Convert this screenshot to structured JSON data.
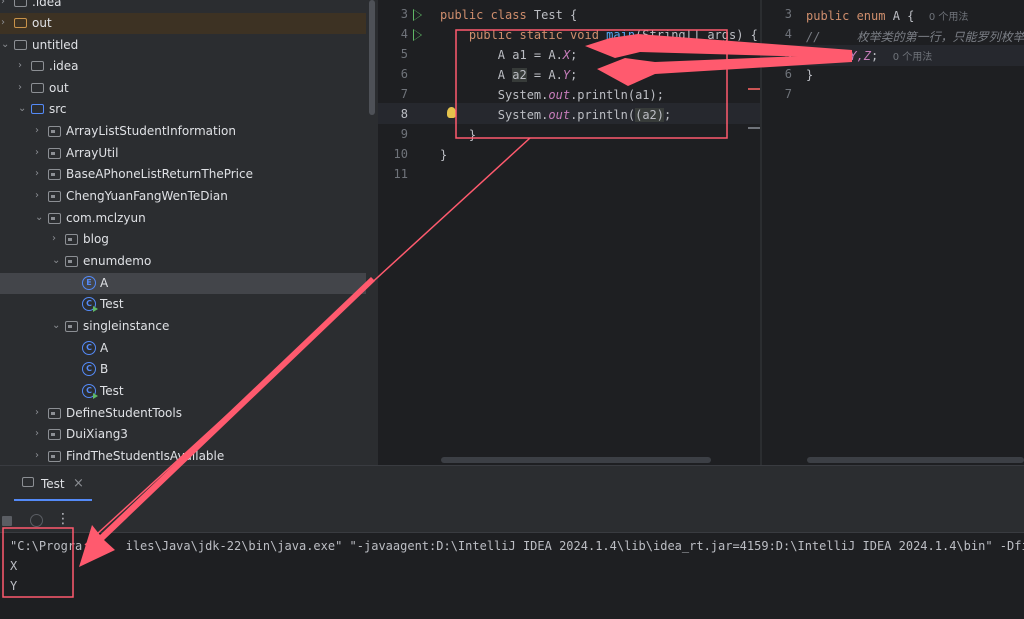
{
  "project_tree": {
    "items": [
      {
        "label": ".idea",
        "kind": "folder"
      },
      {
        "label": "out",
        "kind": "folder-orange"
      },
      {
        "label": "untitled",
        "kind": "folder"
      },
      {
        "label": ".idea",
        "kind": "folder"
      },
      {
        "label": "out",
        "kind": "folder"
      },
      {
        "label": "src",
        "kind": "folder-blue"
      },
      {
        "label": "ArrayListStudentInformation",
        "kind": "package"
      },
      {
        "label": "ArrayUtil",
        "kind": "package"
      },
      {
        "label": "BaseAPhoneListReturnThePrice",
        "kind": "package"
      },
      {
        "label": "ChengYuanFangWenTeDian",
        "kind": "package"
      },
      {
        "label": "com.mclzyun",
        "kind": "package"
      },
      {
        "label": "blog",
        "kind": "package"
      },
      {
        "label": "enumdemo",
        "kind": "package"
      },
      {
        "label": "A",
        "kind": "enum",
        "badge": "E"
      },
      {
        "label": "Test",
        "kind": "class-run",
        "badge": "C"
      },
      {
        "label": "singleinstance",
        "kind": "package"
      },
      {
        "label": "A",
        "kind": "class",
        "badge": "C"
      },
      {
        "label": "B",
        "kind": "class",
        "badge": "C"
      },
      {
        "label": "Test",
        "kind": "class-run",
        "badge": "C"
      },
      {
        "label": "DefineStudentTools",
        "kind": "package"
      },
      {
        "label": "DuiXiang3",
        "kind": "package"
      },
      {
        "label": "FindTheStudentIsAvailable",
        "kind": "package"
      }
    ]
  },
  "editor_left": {
    "line_numbers": [
      "3",
      "4",
      "5",
      "6",
      "7",
      "8",
      "9",
      "10",
      "11"
    ],
    "lines": {
      "l3": {
        "kw1": "public class ",
        "name": "Test",
        "rest": " {"
      },
      "l4": {
        "kw1": "    public static void ",
        "fn": "main",
        "rest": "(String[] args) {"
      },
      "l5": {
        "a": "        A a1 = A.",
        "fld": "X",
        "b": ";"
      },
      "l6": {
        "a": "        A ",
        "hl": "a2",
        "b": " = A.",
        "fld": "Y",
        "c": ";"
      },
      "l7": {
        "a": "        System.",
        "fld": "out",
        "b": ".println(a1);"
      },
      "l8": {
        "a": "        System.",
        "fld": "out",
        "b": ".println(",
        "hl": "(a2)",
        "c": ";"
      },
      "l9": "    }",
      "l10": "}"
    }
  },
  "editor_right": {
    "line_numbers": [
      "3",
      "4",
      "5",
      "6",
      "7"
    ],
    "l3": {
      "kw": "public enum ",
      "name": "A",
      "rest": " {",
      "hint": "0 个用法"
    },
    "l4": {
      "comment": "//     枚举类的第一行，只能罗列枚举对"
    },
    "l5": {
      "vals": "X,Y,Z",
      "semi": ";",
      "hint": "0 个用法"
    },
    "l6": "}"
  },
  "run_panel": {
    "tab_label": "Test",
    "close_glyph": "×",
    "more_glyph": "⋮",
    "command": "\"C:\\Progra      iles\\Java\\jdk-22\\bin\\java.exe\" \"-javaagent:D:\\IntelliJ IDEA 2024.1.4\\lib\\idea_rt.jar=4159:D:\\IntelliJ IDEA 2024.1.4\\bin\" -Dfile",
    "output": [
      "X",
      "Y"
    ]
  },
  "colors": {
    "annotation": "#ff5a6e",
    "accent": "#548af7",
    "run": "#5fb865"
  }
}
